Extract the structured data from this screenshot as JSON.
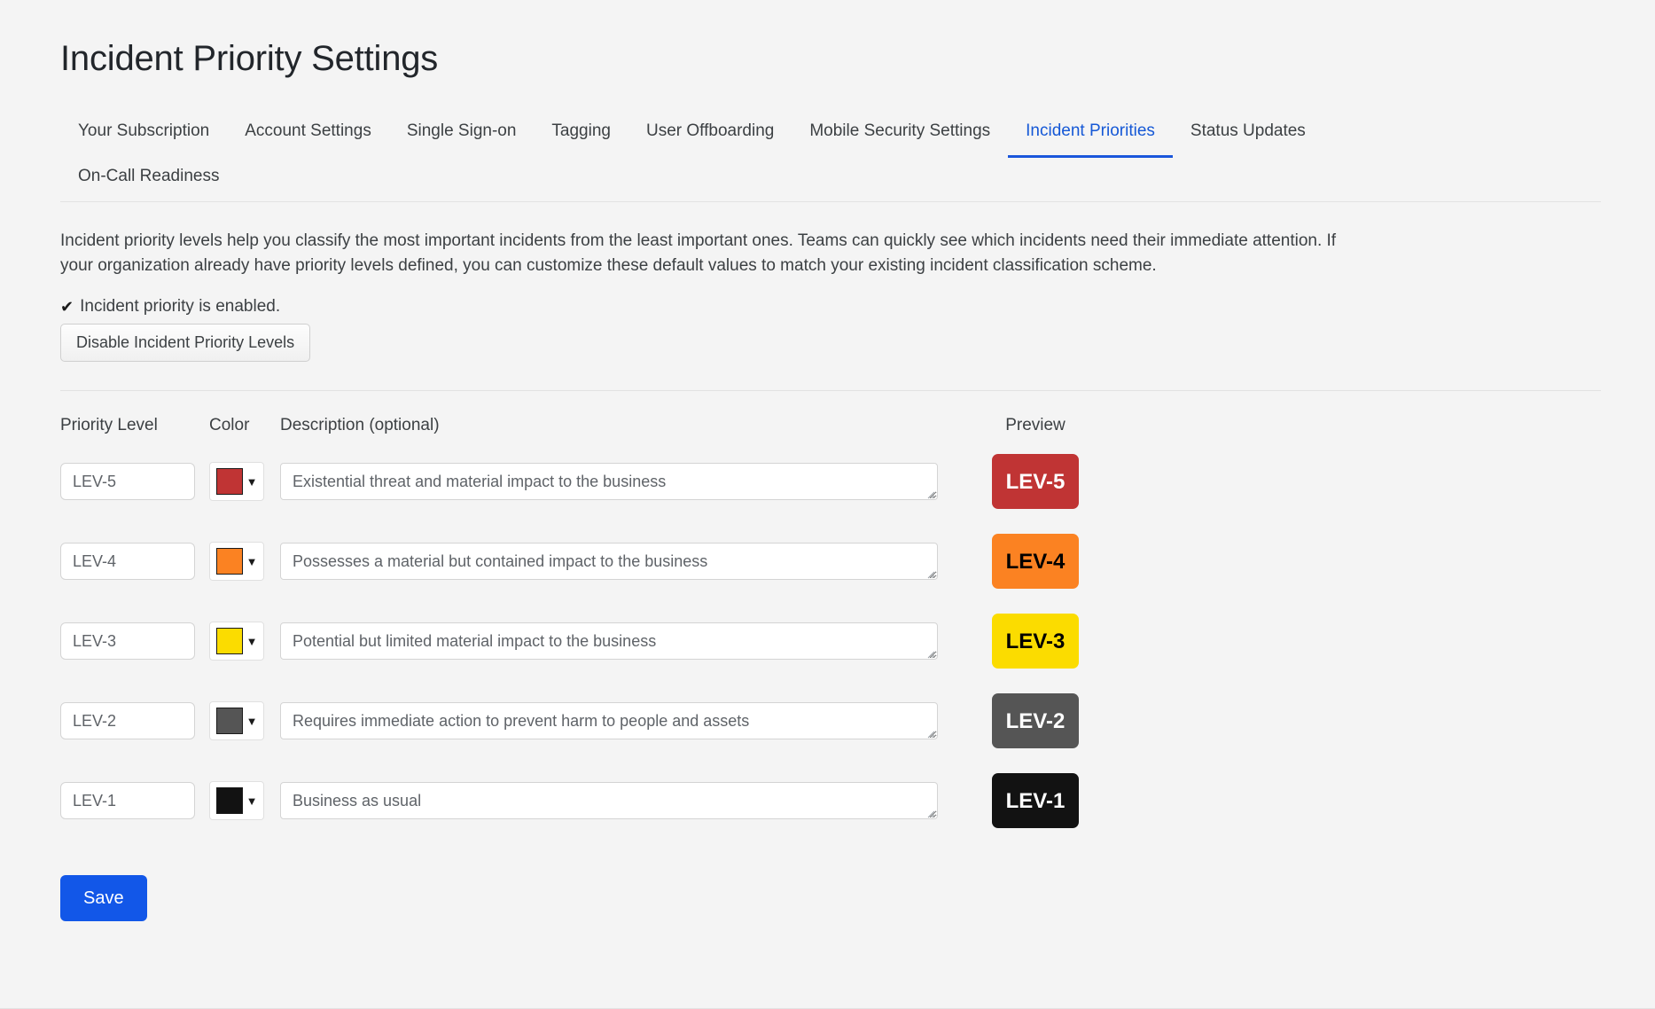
{
  "page": {
    "title": "Incident Priority Settings"
  },
  "tabs": [
    {
      "label": "Your Subscription",
      "active": false
    },
    {
      "label": "Account Settings",
      "active": false
    },
    {
      "label": "Single Sign-on",
      "active": false
    },
    {
      "label": "Tagging",
      "active": false
    },
    {
      "label": "User Offboarding",
      "active": false
    },
    {
      "label": "Mobile Security Settings",
      "active": false
    },
    {
      "label": "Incident Priorities",
      "active": true
    },
    {
      "label": "Status Updates",
      "active": false
    },
    {
      "label": "On-Call Readiness",
      "active": false
    }
  ],
  "description": "Incident priority levels help you classify the most important incidents from the least important ones. Teams can quickly see which incidents need their immediate attention. If your organization already have priority levels defined, you can customize these default values to match your existing incident classification scheme.",
  "status": {
    "check_icon": "check-icon",
    "text": "Incident priority is enabled.",
    "disable_button": "Disable Incident Priority Levels"
  },
  "table": {
    "headers": {
      "level": "Priority Level",
      "color": "Color",
      "description": "Description (optional)",
      "preview": "Preview"
    },
    "rows": [
      {
        "level": "LEV-5",
        "color": "#c03434",
        "text_color": "#ffffff",
        "description": "Existential threat and material impact to the business",
        "badge": "LEV-5"
      },
      {
        "level": "LEV-4",
        "color": "#fb8222",
        "text_color": "#000000",
        "description": "Possesses a material but contained impact to the business",
        "badge": "LEV-4"
      },
      {
        "level": "LEV-3",
        "color": "#fbdc00",
        "text_color": "#000000",
        "description": "Potential but limited material impact to the business",
        "badge": "LEV-3"
      },
      {
        "level": "LEV-2",
        "color": "#555555",
        "text_color": "#ffffff",
        "description": "Requires immediate action to prevent harm to people and assets",
        "badge": "LEV-2"
      },
      {
        "level": "LEV-1",
        "color": "#121212",
        "text_color": "#ffffff",
        "description": "Business as usual",
        "badge": "LEV-1"
      }
    ]
  },
  "actions": {
    "save_label": "Save"
  },
  "colors": {
    "accent": "#1257e8",
    "active_tab": "#1558d6",
    "page_background": "#f4f4f4",
    "text": "#3c4043"
  }
}
